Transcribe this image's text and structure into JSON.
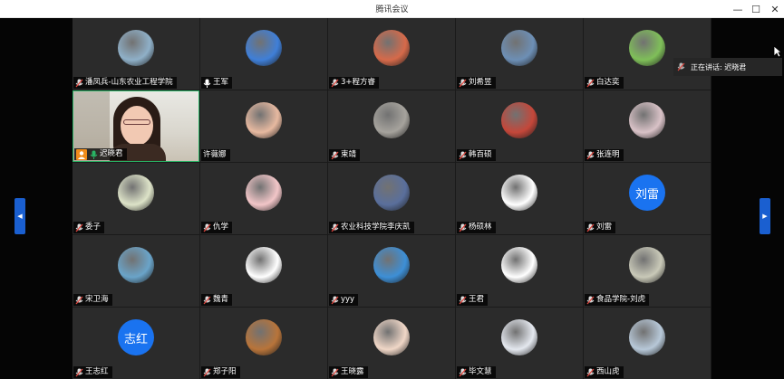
{
  "window": {
    "title": "腾讯会议",
    "controls": {
      "minimize": "—",
      "maximize": "☐",
      "close": "✕"
    }
  },
  "speaking_indicator": {
    "label": "正在讲话: 迟晓君"
  },
  "nav": {
    "prev": "◀",
    "next": "▶"
  },
  "participants": [
    {
      "name": "潘凤兵-山东农业工程学院",
      "avatar": "snow-landscape",
      "color": "#8fb0c8",
      "mic": "muted"
    },
    {
      "name": "王军",
      "avatar": "blue-sky-photo",
      "color": "#3f7fd8",
      "mic": "on"
    },
    {
      "name": "3+程方睿",
      "avatar": "sunset-boat",
      "color": "#d66a4a",
      "mic": "muted"
    },
    {
      "name": "刘希昱",
      "avatar": "island-photo",
      "color": "#6d8fb5",
      "mic": "muted"
    },
    {
      "name": "白达奕",
      "avatar": "green-light",
      "color": "#7fbf59",
      "mic": "muted"
    },
    {
      "name": "迟晓君",
      "avatar": "camera-video",
      "color": "#29b364",
      "mic": "speaking",
      "host": true,
      "video": true
    },
    {
      "name": "许薇娜",
      "avatar": "cartoon-girl",
      "color": "#e7b9a0",
      "mic": "none"
    },
    {
      "name": "束靖",
      "avatar": "cat-photo",
      "color": "#a6a39d",
      "mic": "muted"
    },
    {
      "name": "韩百硕",
      "avatar": "red-flowers",
      "color": "#c4473a",
      "mic": "muted"
    },
    {
      "name": "张连明",
      "avatar": "pink-blossom",
      "color": "#d9c2c7",
      "mic": "muted"
    },
    {
      "name": "委子",
      "avatar": "white-flower",
      "color": "#dde3c8",
      "mic": "muted"
    },
    {
      "name": "仇学",
      "avatar": "anime-girl",
      "color": "#f2c6c8",
      "mic": "muted"
    },
    {
      "name": "农业科技学院李庆凯",
      "avatar": "cartoon-boy",
      "color": "#5a6f9c",
      "mic": "muted"
    },
    {
      "name": "杨硕林",
      "avatar": "cartoon-kid",
      "color": "#ffffff",
      "mic": "muted"
    },
    {
      "name": "刘雷",
      "avatar": "text",
      "text": "刘雷",
      "color": "#1a73f0",
      "mic": "muted"
    },
    {
      "name": "宋卫海",
      "avatar": "beach-photo",
      "color": "#6aa4c9",
      "mic": "muted"
    },
    {
      "name": "魏青",
      "avatar": "sketch-cartoon",
      "color": "#ffffff",
      "mic": "muted"
    },
    {
      "name": "yyy",
      "avatar": "blue-cartoon",
      "color": "#3d8fd6",
      "mic": "muted"
    },
    {
      "name": "王君",
      "avatar": "kid-sunglasses",
      "color": "#ffffff",
      "mic": "muted"
    },
    {
      "name": "食品学院-刘虎",
      "avatar": "daisy",
      "color": "#c9c9b8",
      "mic": "muted"
    },
    {
      "name": "王志红",
      "avatar": "text",
      "text": "志红",
      "color": "#1a73f0",
      "mic": "muted"
    },
    {
      "name": "郑子阳",
      "avatar": "sunset-pyramid",
      "color": "#b8743a",
      "mic": "muted"
    },
    {
      "name": "王晓露",
      "avatar": "baby-photo",
      "color": "#f0d7c7",
      "mic": "muted"
    },
    {
      "name": "毕文慧",
      "avatar": "child-photo",
      "color": "#e4e8ef",
      "mic": "muted"
    },
    {
      "name": "西山虎",
      "avatar": "city-sky",
      "color": "#b7c8d8",
      "mic": "muted"
    }
  ]
}
